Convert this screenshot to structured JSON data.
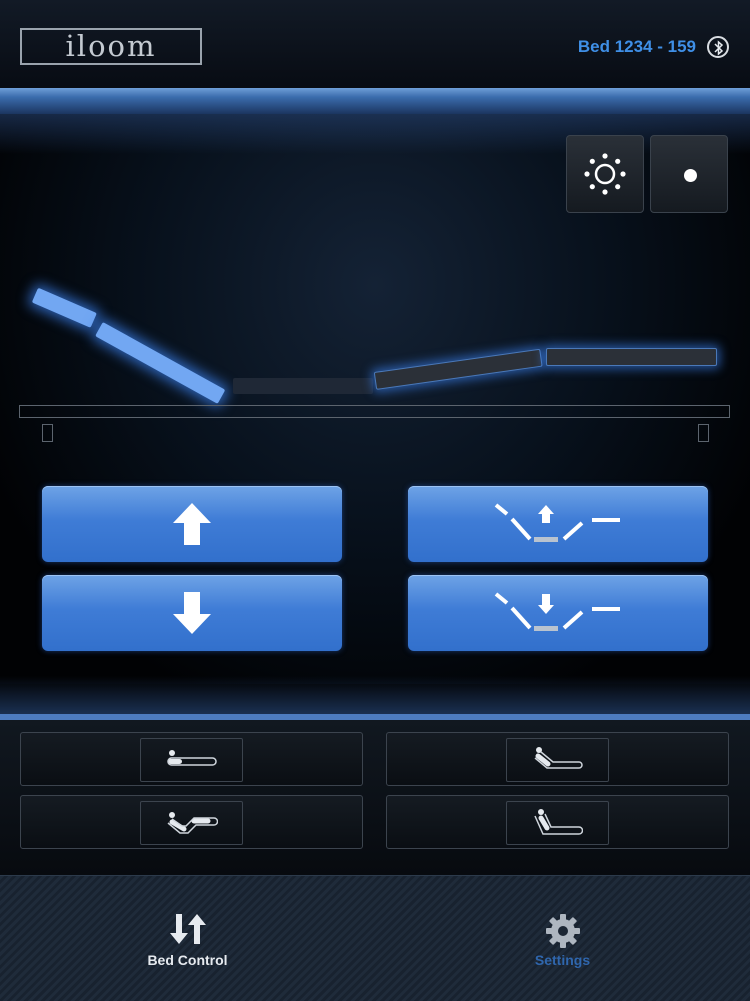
{
  "header": {
    "logo_text": "iloom",
    "bed_id": "Bed 1234 - 159",
    "bluetooth_icon": "bluetooth-icon"
  },
  "bed_status": {
    "head_section": "raised",
    "knee_section": "raised",
    "active_color": "#72a7f2"
  },
  "top_controls": {
    "light_icon": "light-icon",
    "dot_icon": "dot-icon"
  },
  "controls": [
    {
      "id": "raise",
      "icon": "arrow-up-icon"
    },
    {
      "id": "lower",
      "icon": "arrow-down-icon"
    },
    {
      "id": "flat-raise",
      "icon": "bed-up-icon"
    },
    {
      "id": "flat-lower",
      "icon": "bed-down-icon"
    }
  ],
  "presets": [
    {
      "id": "flat",
      "icon": "preset-flat-icon"
    },
    {
      "id": "sit",
      "icon": "preset-sit-icon"
    },
    {
      "id": "zero-gravity",
      "icon": "preset-zero-gravity-icon"
    },
    {
      "id": "upright",
      "icon": "preset-upright-icon"
    }
  ],
  "tabs": [
    {
      "label": "Bed Control",
      "icon": "bed-control-icon",
      "active": true
    },
    {
      "label": "Settings",
      "icon": "gear-icon",
      "active": false
    }
  ],
  "colors": {
    "accent": "#3f8fe6",
    "button_blue": "#3f7cd6",
    "inactive_tab": "#2f66ad"
  }
}
